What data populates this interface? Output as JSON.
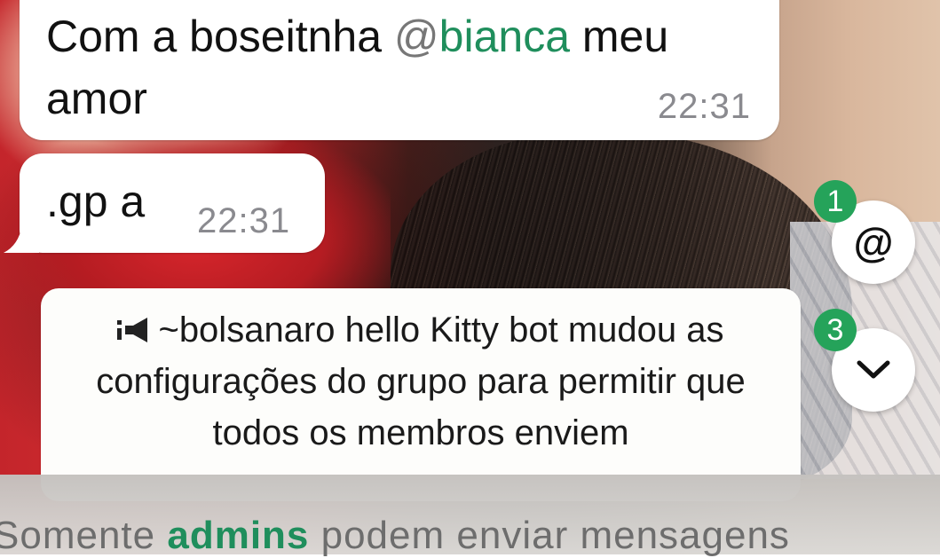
{
  "messages": [
    {
      "text_before": "Com a boseitnha ",
      "mention_at": "@",
      "mention_name": "bianca",
      "text_after": " meu amor",
      "time": "22:31"
    },
    {
      "text": ".gp a",
      "time": "22:31"
    }
  ],
  "notice": {
    "icon": "megaphone-icon",
    "text": "~bolsanaro hello Kitty bot mudou as configurações do grupo para permitir que todos os membros enviem"
  },
  "buttons": {
    "mention_glyph": "@",
    "mention_badge": "1",
    "scroll_icon": "chevron-down-icon",
    "scroll_badge": "3"
  },
  "footer": {
    "text_before": "Somente ",
    "highlight": "admins",
    "text_after": " podem enviar mensagens"
  },
  "colors": {
    "accent_green": "#1f8e5c",
    "badge_green": "#25a35a",
    "bubble": "#ffffff",
    "timestamp": "#8a8a8f"
  }
}
